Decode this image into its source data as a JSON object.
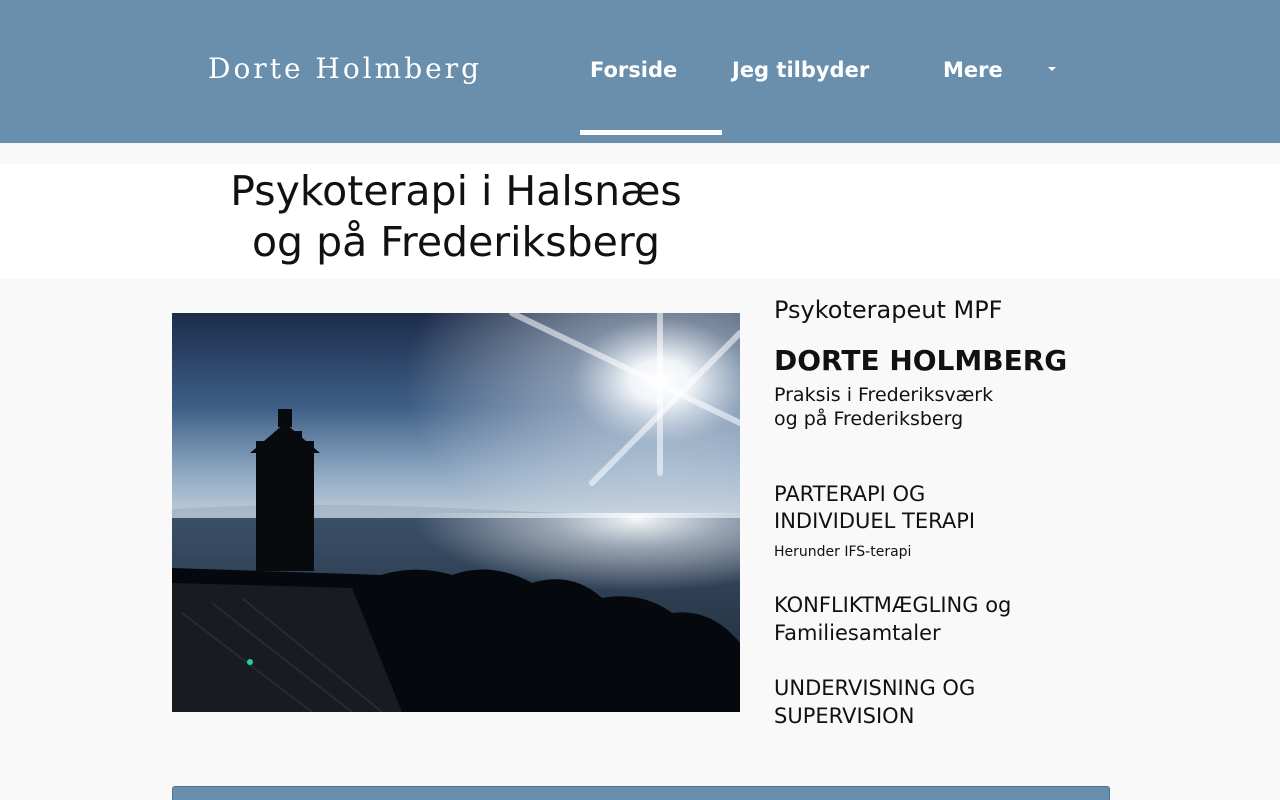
{
  "header": {
    "brand": "Dorte Holmberg",
    "nav": [
      {
        "label": "Forside",
        "active": true
      },
      {
        "label": "Jeg tilbyder",
        "active": false
      },
      {
        "label": "Mere",
        "active": false
      }
    ]
  },
  "hero": {
    "title_line1": "Psykoterapi i Halsnæs",
    "title_line2": "og på Frederiksberg"
  },
  "profile": {
    "subtitle": "Psykoterapeut MPF",
    "name": "DORTE HOLMBERG",
    "place_line1": "Praksis i Frederiksværk",
    "place_line2": "og på Frederiksberg"
  },
  "services": [
    {
      "line1": "PARTERAPI OG",
      "line2": "INDIVIDUEL TERAPI",
      "note": "Herunder IFS-terapi"
    },
    {
      "line1": "KONFLIKTMÆGLING og",
      "line2": "Familiesamtaler"
    },
    {
      "line1": "UNDERVISNING OG",
      "line2": "SUPERVISION"
    }
  ],
  "colors": {
    "header_bg": "#6a8fad",
    "page_bg": "#f9f9f9",
    "text": "#111111"
  }
}
